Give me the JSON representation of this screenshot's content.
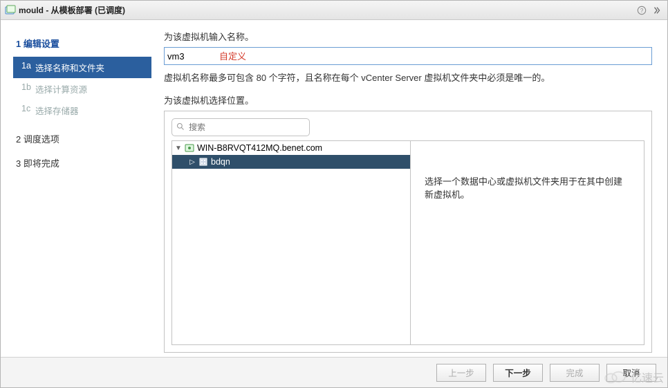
{
  "titlebar": {
    "title": "mould - 从模板部署 (已调度)"
  },
  "sidebar": {
    "step1": {
      "num": "1",
      "label": "编辑设置"
    },
    "step1a": {
      "num": "1a",
      "label": "选择名称和文件夹"
    },
    "step1b": {
      "num": "1b",
      "label": "选择计算资源"
    },
    "step1c": {
      "num": "1c",
      "label": "选择存储器"
    },
    "step2": {
      "num": "2",
      "label": "调度选项"
    },
    "step3": {
      "num": "3",
      "label": "即将完成"
    }
  },
  "main": {
    "enterNameLabel": "为该虚拟机输入名称。",
    "vmName": "vm3",
    "customAnnotation": "自定义",
    "charHint": "虚拟机名称最多可包含 80 个字符，且名称在每个 vCenter Server 虚拟机文件夹中必须是唯一的。",
    "selectLocationLabel": "为该虚拟机选择位置。",
    "searchPlaceholder": "搜索",
    "tree": {
      "root": "WIN-B8RVQT412MQ.benet.com",
      "child": "bdqn"
    },
    "detailText": "选择一个数据中心或虚拟机文件夹用于在其中创建新虚拟机。"
  },
  "footer": {
    "back": "上一步",
    "next": "下一步",
    "finish": "完成",
    "cancel": "取消"
  },
  "watermark": "亿速云"
}
